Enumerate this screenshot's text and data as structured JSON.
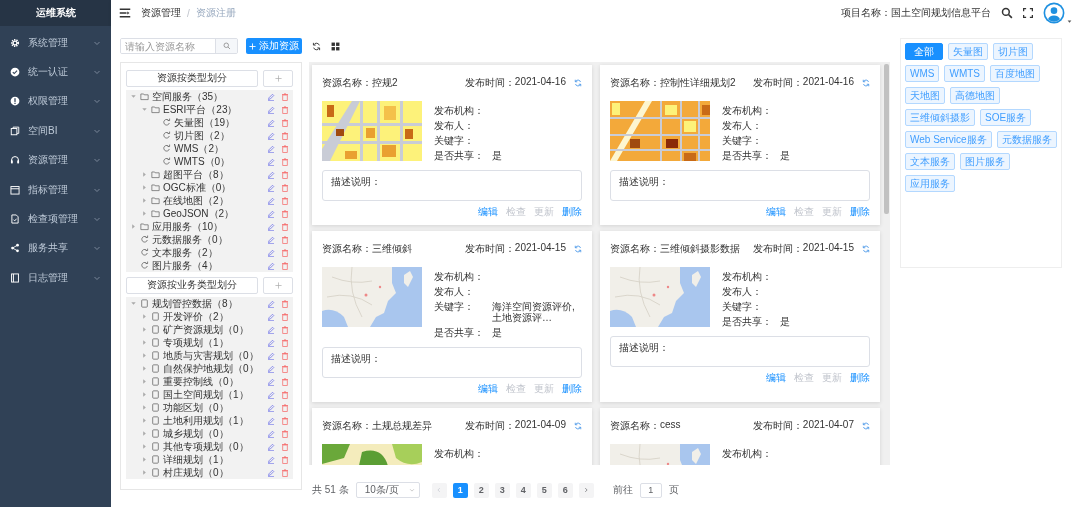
{
  "sidebar": {
    "title": "运维系统",
    "items": [
      {
        "label": "系统管理"
      },
      {
        "label": "统一认证"
      },
      {
        "label": "权限管理"
      },
      {
        "label": "空间BI"
      },
      {
        "label": "资源管理"
      },
      {
        "label": "指标管理"
      },
      {
        "label": "检查项管理"
      },
      {
        "label": "服务共享"
      },
      {
        "label": "日志管理"
      }
    ]
  },
  "topbar": {
    "breadcrumb": [
      "资源管理",
      "资源注册"
    ],
    "breadcrumb_separator": "/",
    "project": "项目名称：国土空间规划信息平台"
  },
  "toolbar": {
    "search": {
      "placeholder": "请输入资源名称"
    },
    "add_button": "添加资源"
  },
  "tree_sections": [
    {
      "header": "资源按类型划分",
      "items": [
        {
          "label": "空间服务（35）",
          "kind": "folder",
          "expanded": true,
          "children": [
            {
              "label": "ESRI平台（23）",
              "kind": "folder",
              "expanded": true,
              "children": [
                {
                  "label": "矢量图（19）",
                  "kind": "service"
                },
                {
                  "label": "切片图（2）",
                  "kind": "service"
                },
                {
                  "label": "WMS（2）",
                  "kind": "service"
                },
                {
                  "label": "WMTS（0）",
                  "kind": "service"
                }
              ]
            },
            {
              "label": "超图平台（8）",
              "kind": "folder",
              "expanded": false
            },
            {
              "label": "OGC标准（0）",
              "kind": "folder",
              "expanded": false
            },
            {
              "label": "在线地图（2）",
              "kind": "folder",
              "expanded": false
            },
            {
              "label": "GeoJSON（2）",
              "kind": "folder",
              "expanded": false
            }
          ]
        },
        {
          "label": "应用服务（10）",
          "kind": "folder",
          "expanded": false
        },
        {
          "label": "元数据服务（0）",
          "kind": "service"
        },
        {
          "label": "文本服务（2）",
          "kind": "service"
        },
        {
          "label": "图片服务（4）",
          "kind": "service"
        }
      ]
    },
    {
      "header": "资源按业务类型划分",
      "items": [
        {
          "label": "规划管控数据（8）",
          "kind": "doc",
          "expanded": true,
          "children": [
            {
              "label": "开发评价（2）",
              "kind": "doc",
              "expanded": false
            },
            {
              "label": "矿产资源规划（0）",
              "kind": "doc",
              "expanded": false
            },
            {
              "label": "专项规划（1）",
              "kind": "doc",
              "expanded": false
            },
            {
              "label": "地质与灾害规划（0）",
              "kind": "doc",
              "expanded": false
            },
            {
              "label": "自然保护地规划（0）",
              "kind": "doc",
              "expanded": false
            },
            {
              "label": "重要控制线（0）",
              "kind": "doc",
              "expanded": false
            },
            {
              "label": "国土空间规划（1）",
              "kind": "doc",
              "expanded": false
            },
            {
              "label": "功能区划（0）",
              "kind": "doc",
              "expanded": false
            },
            {
              "label": "土地利用规划（1）",
              "kind": "doc",
              "expanded": false
            },
            {
              "label": "城乡规划（0）",
              "kind": "doc",
              "expanded": false
            },
            {
              "label": "其他专项规划（0）",
              "kind": "doc",
              "expanded": false
            },
            {
              "label": "详细规划（1）",
              "kind": "doc",
              "expanded": false
            },
            {
              "label": "村庄规划（0）",
              "kind": "doc",
              "expanded": false
            }
          ]
        }
      ]
    }
  ],
  "cards": [
    {
      "name_label": "资源名称：",
      "name": "控规2",
      "time_label": "发布时间：",
      "time": "2021-04-16",
      "thumbnail": {
        "kind": "picture"
      },
      "fields": [
        {
          "label": "发布机构："
        },
        {
          "label": "发布人："
        },
        {
          "label": "关键字："
        },
        {
          "label": "是否共享：",
          "value": "是"
        }
      ],
      "description_label": "描述说明：",
      "actions": [
        {
          "label": "编辑",
          "disabled": false
        },
        {
          "label": "检查",
          "disabled": true
        },
        {
          "label": "更新",
          "disabled": true
        },
        {
          "label": "删除",
          "disabled": false
        }
      ]
    },
    {
      "name_label": "资源名称：",
      "name": "控制性详细规划2",
      "time_label": "发布时间：",
      "time": "2021-04-16",
      "thumbnail": {
        "kind": "picture"
      },
      "fields": [
        {
          "label": "发布机构："
        },
        {
          "label": "发布人："
        },
        {
          "label": "关键字："
        },
        {
          "label": "是否共享：",
          "value": "是"
        }
      ],
      "description_label": "描述说明：",
      "actions": [
        {
          "label": "编辑",
          "disabled": false
        },
        {
          "label": "检查",
          "disabled": true
        },
        {
          "label": "更新",
          "disabled": true
        },
        {
          "label": "删除",
          "disabled": false
        }
      ]
    },
    {
      "name_label": "资源名称：",
      "name": "三维倾斜",
      "time_label": "发布时间：",
      "time": "2021-04-15",
      "thumbnail": {
        "kind": "picture"
      },
      "fields": [
        {
          "label": "发布机构："
        },
        {
          "label": "发布人："
        },
        {
          "label": "关键字：",
          "value": "海洋空间资源评价,土地资源评…"
        },
        {
          "label": "是否共享：",
          "value": "是"
        }
      ],
      "description_label": "描述说明：",
      "actions": [
        {
          "label": "编辑",
          "disabled": false
        },
        {
          "label": "检查",
          "disabled": true
        },
        {
          "label": "更新",
          "disabled": true
        },
        {
          "label": "删除",
          "disabled": false
        }
      ]
    },
    {
      "name_label": "资源名称：",
      "name": "三维倾斜摄影数据",
      "time_label": "发布时间：",
      "time": "2021-04-15",
      "thumbnail": {
        "kind": "picture"
      },
      "fields": [
        {
          "label": "发布机构："
        },
        {
          "label": "发布人："
        },
        {
          "label": "关键字："
        },
        {
          "label": "是否共享：",
          "value": "是"
        }
      ],
      "description_label": "描述说明：",
      "actions": [
        {
          "label": "编辑",
          "disabled": false
        },
        {
          "label": "检查",
          "disabled": true
        },
        {
          "label": "更新",
          "disabled": true
        },
        {
          "label": "删除",
          "disabled": false
        }
      ]
    },
    {
      "name_label": "资源名称：",
      "name": "土规总规差异",
      "time_label": "发布时间：",
      "time": "2021-04-09",
      "thumbnail": {
        "kind": "picture"
      },
      "fields": [
        {
          "label": "发布机构："
        }
      ]
    },
    {
      "name_label": "资源名称：",
      "name": "cess",
      "time_label": "发布时间：",
      "time": "2021-04-07",
      "thumbnail": {
        "kind": "picture"
      },
      "fields": [
        {
          "label": "发布机构："
        }
      ]
    }
  ],
  "pagination": {
    "total": "共 51 条",
    "page_size": "10条/页",
    "pages": [
      {
        "label": "1",
        "selected": true
      },
      {
        "label": "2",
        "selected": false
      },
      {
        "label": "3",
        "selected": false
      },
      {
        "label": "4",
        "selected": false
      },
      {
        "label": "5",
        "selected": false
      },
      {
        "label": "6",
        "selected": false
      }
    ],
    "goto_label": "前往",
    "goto_value": "1",
    "goto_suffix": "页"
  },
  "tags": [
    {
      "label": "全部",
      "selected": true
    },
    {
      "label": "矢量图",
      "selected": false
    },
    {
      "label": "切片图",
      "selected": false
    },
    {
      "label": "WMS",
      "selected": false
    },
    {
      "label": "WMTS",
      "selected": false
    },
    {
      "label": "百度地图",
      "selected": false
    },
    {
      "label": "天地图",
      "selected": false
    },
    {
      "label": "高德地图",
      "selected": false
    },
    {
      "label": "三维倾斜摄影",
      "selected": false
    },
    {
      "label": "SOE服务",
      "selected": false
    },
    {
      "label": "Web Service服务",
      "selected": false
    },
    {
      "label": "元数据服务",
      "selected": false
    },
    {
      "label": "文本服务",
      "selected": false
    },
    {
      "label": "图片服务",
      "selected": false
    },
    {
      "label": "应用服务",
      "selected": false
    }
  ]
}
